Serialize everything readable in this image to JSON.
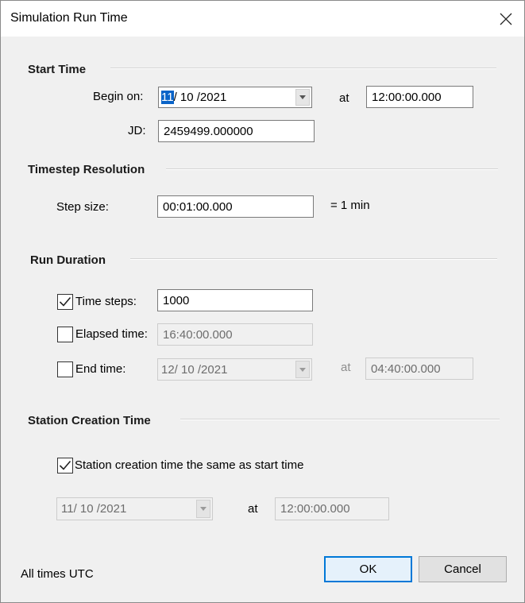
{
  "window": {
    "title": "Simulation Run Time"
  },
  "start_time": {
    "heading": "Start Time",
    "begin_label": "Begin on:",
    "begin_date_selected": "11",
    "begin_date_rest": "/ 10 /2021",
    "at_label": "at",
    "begin_time": "12:00:00.000",
    "jd_label": "JD:",
    "jd_value": "2459499.000000"
  },
  "timestep": {
    "heading": "Timestep Resolution",
    "step_label": "Step size:",
    "step_value": "00:01:00.000",
    "step_readout": "= 1 min"
  },
  "run_duration": {
    "heading": "Run Duration",
    "time_steps_label": "Time steps:",
    "time_steps_checked": true,
    "time_steps_value": "1000",
    "elapsed_label": "Elapsed time:",
    "elapsed_checked": false,
    "elapsed_value": "16:40:00.000",
    "end_label": "End time:",
    "end_checked": false,
    "end_date": "12/ 10 /2021",
    "end_at_label": "at",
    "end_time": "04:40:00.000"
  },
  "station": {
    "heading": "Station Creation Time",
    "same_label": "Station creation time the same as start time",
    "same_checked": true,
    "date": "11/ 10 /2021",
    "at_label": "at",
    "time": "12:00:00.000"
  },
  "footer": {
    "note": "All times UTC",
    "ok_label": "OK",
    "cancel_label": "Cancel"
  },
  "icons": {
    "close": "close-icon",
    "dropdown": "chevron-down-icon",
    "check": "checkmark-icon"
  },
  "colors": {
    "selection": "#0a64c8",
    "default_button_border": "#0078d7"
  }
}
